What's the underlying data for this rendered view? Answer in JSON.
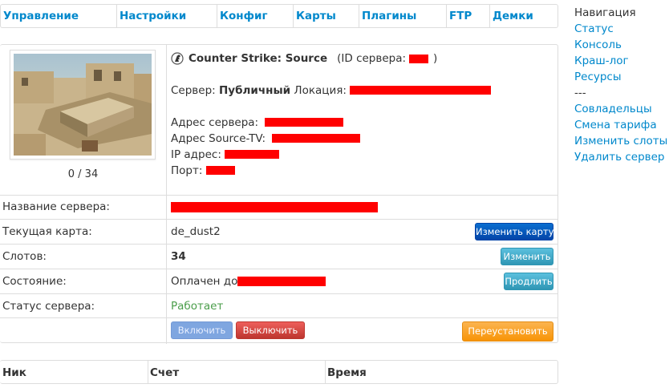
{
  "topnav": [
    "Управление",
    "Настройки",
    "Конфиг",
    "Карты",
    "Плагины",
    "FTP",
    "Демки"
  ],
  "sidenav": {
    "heading": "Навигация",
    "group1": [
      "Статус",
      "Консоль",
      "Краш-лог",
      "Ресурсы"
    ],
    "separator": "---",
    "group2": [
      "Совладельцы",
      "Смена тарифа",
      "Изменить слоты",
      "Удалить сервер"
    ]
  },
  "server": {
    "game": "Counter Strike: Source",
    "id_label": "(ID сервера:",
    "id_close": ")",
    "type_label": "Сервер:",
    "type_value": "Публичный",
    "location_label": "Локация:",
    "address_label": "Адрес сервера:",
    "sourcetv_label": "Адрес Source-TV:",
    "ip_label": "IP адрес:",
    "port_label": "Порт:",
    "players": "0 / 34"
  },
  "rows": {
    "name_label": "Название сервера:",
    "map_label": "Текущая карта:",
    "map_value": "de_dust2",
    "map_button": "Изменить карту",
    "slots_label": "Слотов:",
    "slots_value": "34",
    "slots_button": "Изменить",
    "state_label": "Состояние:",
    "state_value": "Оплачен до",
    "state_button": "Продлить",
    "status_label": "Статус сервера:",
    "status_value": "Работает"
  },
  "actions": {
    "start": "Включить",
    "stop": "Выключить",
    "reinstall": "Переустановить"
  },
  "stats_columns": [
    "Ник",
    "Счет",
    "Время"
  ],
  "colors": {
    "link": "#0088cc",
    "redaction": "#ff0000",
    "status_ok": "#4a9d4a"
  }
}
